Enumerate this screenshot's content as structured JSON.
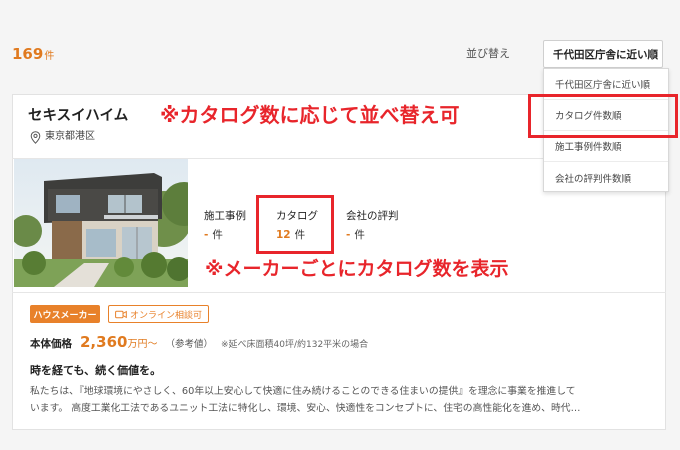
{
  "results": {
    "count": "169",
    "unit": "件"
  },
  "sort": {
    "label": "並び替え",
    "selected": "千代田区庁舎に近い順",
    "options": [
      "千代田区庁舎に近い順",
      "カタログ件数順",
      "施工事例件数順",
      "会社の評判件数順"
    ]
  },
  "annotations": {
    "sort_note": "※カタログ数に応じて並べ替え可",
    "catalog_note": "※メーカーごとにカタログ数を表示"
  },
  "card": {
    "company": "セキスイハイム",
    "location": "東京都港区",
    "stats": [
      {
        "title": "施工事例",
        "value": "-",
        "unit": "件"
      },
      {
        "title": "カタログ",
        "value": "12",
        "unit": "件"
      },
      {
        "title": "会社の評判",
        "value": "-",
        "unit": "件"
      }
    ],
    "badges": {
      "type": "ハウスメーカー",
      "online": "オンライン相談可"
    },
    "price": {
      "label": "本体価格",
      "value": "2,360",
      "unit": "万円〜",
      "ref": "（参考値）",
      "note": "※延べ床面積40坪/約132平米の場合"
    },
    "headline": "時を経ても、続く価値を。",
    "description": [
      "私たちは、『地球環境にやさしく、60年以上安心して快適に住み続けることのできる住まいの提供』を理念に事業を推進して",
      "います。 高度工業化工法であるユニット工法に特化し、環境、安心、快適性をコンセプトに、住宅の高性能化を進め、時代…"
    ]
  },
  "colors": {
    "accent": "#e07a1f",
    "annotation": "#e8252b"
  }
}
